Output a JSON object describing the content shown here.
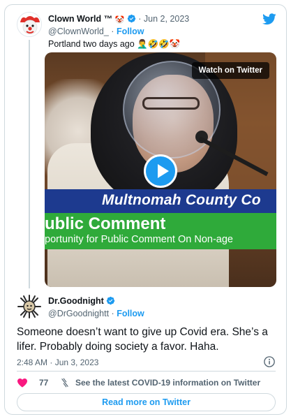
{
  "quoted_tweet": {
    "display_name": "Clown World ™",
    "name_emoji": "🤡",
    "date_prefix": "· Jun 2, 2023",
    "handle": "@ClownWorld_",
    "follow_separator": "·",
    "follow_label": "Follow",
    "text": "Portland two days ago 🤦‍♂️🤣🤣🤡"
  },
  "video": {
    "watch_label": "Watch on Twitter",
    "chyron_blue": "Multnomah County Co",
    "chyron_green_title": "ublic Comment",
    "chyron_green_subtitle": "portunity for Public Comment On Non-age"
  },
  "main_tweet": {
    "display_name": "Dr.Goodnight",
    "handle": "@DrGoodnightt",
    "follow_separator": "·",
    "follow_label": "Follow",
    "text": "Someone doesn’t want to give up Covid era. She’s a lifer. Probably doing society a favor. Haha.",
    "timestamp": "2:48 AM · Jun 3, 2023"
  },
  "actions": {
    "like_count": "77",
    "covid_link": "See the latest COVID-19 information on Twitter"
  },
  "footer": {
    "read_more": "Read more on Twitter"
  },
  "colors": {
    "twitter_blue": "#1d9bf0",
    "like_red": "#f91880",
    "muted_text": "#536471",
    "border": "#cfd9de"
  },
  "icons": [
    "clown-avatar",
    "verified-icon",
    "twitter-logo-icon",
    "play-icon",
    "goodnight-avatar",
    "info-icon",
    "heart-icon",
    "covid-info-icon"
  ]
}
